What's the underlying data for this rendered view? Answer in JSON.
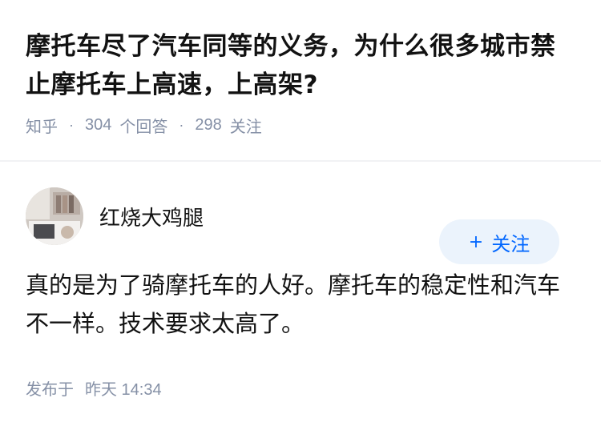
{
  "question": {
    "title": "摩托车尽了汽车同等的义务，为什么很多城市禁止摩托车上高速，上高架?",
    "source": "知乎",
    "answer_count": "304",
    "answer_label": "个回答",
    "follower_count": "298",
    "follower_label": "关注"
  },
  "answer": {
    "author_name": "红烧大鸡腿",
    "follow_label": "关注",
    "content": "真的是为了骑摩托车的人好。摩托车的稳定性和汽车不一样。技术要求太高了。",
    "published_label": "发布于",
    "published_time": "昨天 14:34"
  },
  "colors": {
    "accent": "#0066ff",
    "follow_bg": "#ebf3fc",
    "meta_text": "#8590a6"
  }
}
